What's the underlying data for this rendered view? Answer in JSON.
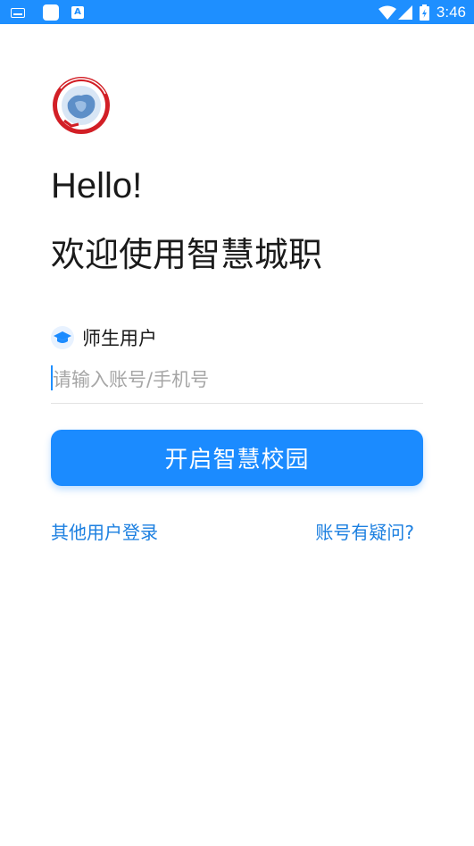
{
  "status_bar": {
    "time": "3:46",
    "icons": [
      "keyboard-icon",
      "app-icon",
      "a-icon",
      "wifi-icon",
      "signal-icon",
      "battery-icon"
    ],
    "color": "#1e8fff",
    "a_icon_text": "A"
  },
  "logo": {
    "icon": "school-emblem-icon"
  },
  "greeting": "Hello!",
  "welcome_text": "欢迎使用智慧城职",
  "user_type": {
    "icon": "graduation-cap-icon",
    "label": "师生用户"
  },
  "account_input": {
    "value": "",
    "placeholder": "请输入账号/手机号"
  },
  "primary_button": {
    "label": "开启智慧校园",
    "color": "#1b8bff"
  },
  "links": {
    "other_login": "其他用户登录",
    "account_help": "账号有疑问?"
  }
}
